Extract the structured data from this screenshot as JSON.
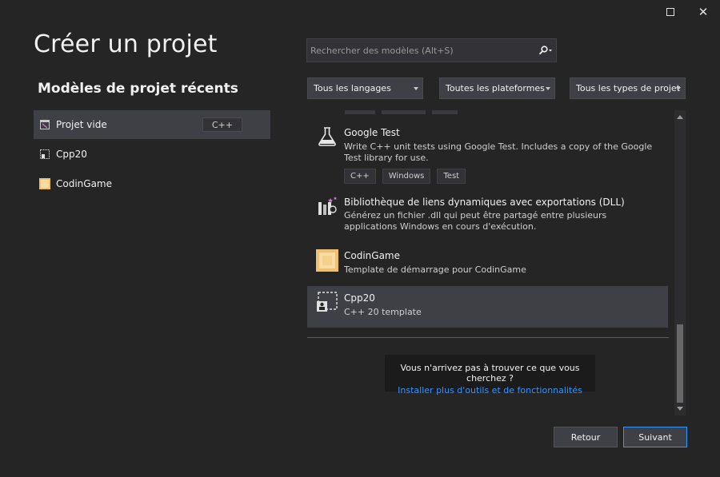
{
  "window": {
    "maximize_icon": "maximize-icon",
    "close_glyph": "✕"
  },
  "page": {
    "title": "Créer un projet"
  },
  "recent": {
    "title": "Modèles de projet récents",
    "items": [
      {
        "name": "Projet vide",
        "tag": "C++",
        "icon": "empty-project-icon"
      },
      {
        "name": "Cpp20",
        "tag": "",
        "icon": "cpp20-template-icon"
      },
      {
        "name": "CodinGame",
        "tag": "",
        "icon": "codingame-icon"
      }
    ]
  },
  "search": {
    "placeholder": "Rechercher des modèles (Alt+S)",
    "value": ""
  },
  "filters": {
    "language": "Tous les langages",
    "platform": "Toutes les plateformes",
    "project_type": "Tous les types de projet"
  },
  "templates": [
    {
      "name": "Google Test",
      "desc": "Write C++ unit tests using Google Test. Includes a copy of the Google Test library for use.",
      "tags": [
        "C++",
        "Windows",
        "Test"
      ],
      "icon": "flask-icon"
    },
    {
      "name": "Bibliothèque de liens dynamiques avec exportations (DLL)",
      "desc": "Générez un fichier .dll qui peut être partagé entre plusieurs applications Windows en cours d'exécution.",
      "tags": [],
      "icon": "dll-library-icon"
    },
    {
      "name": "CodinGame",
      "desc": "Template de démarrage pour CodinGame",
      "tags": [],
      "icon": "codingame-icon"
    },
    {
      "name": "Cpp20",
      "desc": "C++ 20 template",
      "tags": [],
      "icon": "cpp20-template-icon"
    }
  ],
  "help": {
    "text": "Vous n'arrivez pas à trouver ce que vous cherchez ?",
    "link": "Installer plus d'outils et de fonctionnalités"
  },
  "buttons": {
    "back": "Retour",
    "next": "Suivant"
  },
  "colors": {
    "accent": "#3794ff",
    "background": "#252526",
    "selected": "#3f3f46"
  }
}
